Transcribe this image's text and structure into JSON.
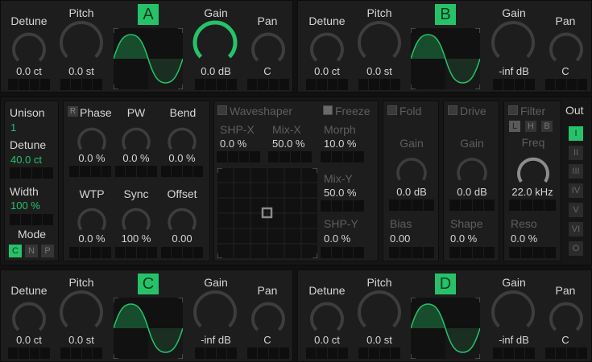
{
  "osc": [
    {
      "letter": "A",
      "detune_label": "Detune",
      "pitch_label": "Pitch",
      "gain_label": "Gain",
      "pan_label": "Pan",
      "detune": "0.0 ct",
      "pitch": "0.0 st",
      "gain": "0.0 dB",
      "pan": "C",
      "gain_level": 1.0
    },
    {
      "letter": "B",
      "detune_label": "Detune",
      "pitch_label": "Pitch",
      "gain_label": "Gain",
      "pan_label": "Pan",
      "detune": "0.0 ct",
      "pitch": "0.0 st",
      "gain": "-inf dB",
      "pan": "C",
      "gain_level": 0.0
    },
    {
      "letter": "C",
      "detune_label": "Detune",
      "pitch_label": "Pitch",
      "gain_label": "Gain",
      "pan_label": "Pan",
      "detune": "0.0 ct",
      "pitch": "0.0 st",
      "gain": "-inf dB",
      "pan": "C",
      "gain_level": 0.0
    },
    {
      "letter": "D",
      "detune_label": "Detune",
      "pitch_label": "Pitch",
      "gain_label": "Gain",
      "pan_label": "Pan",
      "detune": "0.0 ct",
      "pitch": "0.0 st",
      "gain": "-inf dB",
      "pan": "C",
      "gain_level": 0.0
    }
  ],
  "voice": {
    "unison_label": "Unison",
    "unison": "1",
    "detune_label": "Detune",
    "detune": "40.0 ct",
    "width_label": "Width",
    "width": "100 %",
    "mode_label": "Mode",
    "modes": [
      "C",
      "N",
      "P"
    ]
  },
  "phase": {
    "reset": "R",
    "phase_label": "Phase",
    "phase": "0.0 %",
    "pw_label": "PW",
    "pw": "0.0 %",
    "bend_label": "Bend",
    "bend": "0.0 %",
    "wtp_label": "WTP",
    "wtp": "0.0 %",
    "sync_label": "Sync",
    "sync": "100 %",
    "offset_label": "Offset",
    "offset": "0.00"
  },
  "waveshaper": {
    "title": "Waveshaper",
    "freeze": "Freeze",
    "shpx_label": "SHP-X",
    "shpx": "0.0 %",
    "mixx_label": "Mix-X",
    "mixx": "50.0 %",
    "morph_label": "Morph",
    "morph": "10.0 %",
    "mixy_label": "Mix-Y",
    "mixy": "50.0 %",
    "shpy_label": "SHP-Y",
    "shpy": "0.0 %"
  },
  "fold": {
    "title": "Fold",
    "gain_label": "Gain",
    "gain": "0.0 dB",
    "bias_label": "Bias",
    "bias": "0.00"
  },
  "drive": {
    "title": "Drive",
    "gain_label": "Gain",
    "gain": "0.0 dB",
    "shape_label": "Shape",
    "shape": "0.0 %"
  },
  "filter": {
    "title": "Filter",
    "types": [
      "L",
      "H",
      "B"
    ],
    "freq_label": "Freq",
    "freq": "22.0 kHz",
    "reso_label": "Reso",
    "reso": "0.0 %"
  },
  "out": {
    "title": "Out",
    "items": [
      "I",
      "II",
      "III",
      "IV",
      "V",
      "VI",
      "O"
    ]
  },
  "colors": {
    "accent": "#26c26a",
    "panel": "#1d1d1d",
    "knob_track": "#3d3d3d",
    "knob_value": "#8c8c8c"
  }
}
